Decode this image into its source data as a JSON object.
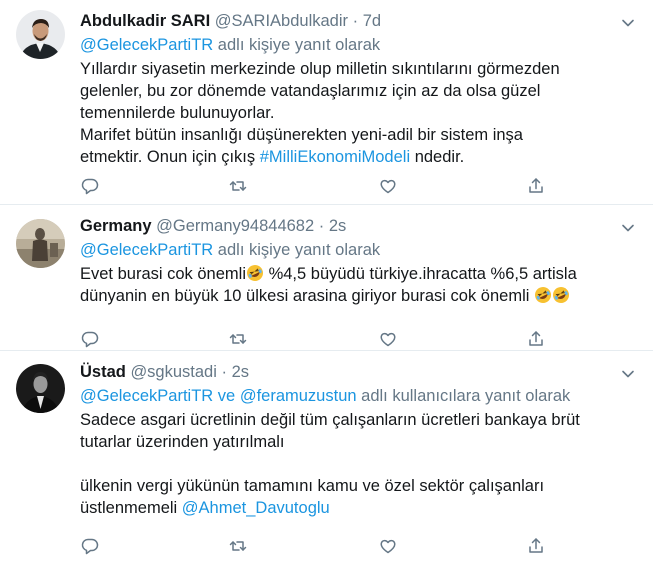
{
  "tweets": [
    {
      "name": "Abdulkadir SARI",
      "handle": "@SARIAbdulkadir",
      "time": "7d",
      "reply_mentions": [
        "@GelecekPartiTR"
      ],
      "reply_connector": "",
      "reply_suffix": "adlı kişiye yanıt olarak",
      "lines": [
        "Yıllardır siyasetin merkezinde olup milletin sıkıntılarını görmezden",
        "gelenler, bu zor dönemde vatandaşlarımız için az da olsa güzel",
        "temennilerde bulunuyorlar.",
        "Marifet bütün insanlığı düşünerekten yeni-adil bir sistem inşa"
      ],
      "last_line_prefix": "etmektir. Onun için çıkış ",
      "hashtag": "#MilliEkonomiModeli",
      "last_line_suffix": " ndedir."
    },
    {
      "name": "Germany",
      "handle": "@Germany94844682",
      "time": "2s",
      "reply_mentions": [
        "@GelecekPartiTR"
      ],
      "reply_connector": "",
      "reply_suffix": "adlı kişiye yanıt olarak",
      "line1_prefix": "Evet burasi cok önemli",
      "line1_suffix": " %4,5 büyüdü türkiye.ihracatta %6,5 artisla",
      "line2": "dünyanin en büyük 10 ülkesi arasina giriyor burasi cok önemli "
    },
    {
      "name": "Üstad",
      "handle": "@sgkustadi",
      "time": "2s",
      "reply_mentions": [
        "@GelecekPartiTR",
        "@feramuzustun"
      ],
      "reply_connector": "ve",
      "reply_suffix": "adlı kullanıcılara yanıt olarak",
      "lines": [
        "Sadece asgari ücretlinin değil tüm çalışanların ücretleri bankaya brüt",
        "tutarlar üzerinden yatırılmalı",
        "",
        "ülkenin vergi yükünün tamamını kamu ve özel sektör çalışanları"
      ],
      "last_line_prefix": "üstlenmemeli ",
      "last_mention": "@Ahmet_Davutoglu"
    }
  ],
  "icons": {
    "reply": "reply-icon",
    "retweet": "retweet-icon",
    "like": "like-icon",
    "share": "share-icon",
    "more": "chevron-down-icon",
    "emoji": "rolling-on-floor-laughing-emoji"
  },
  "colors": {
    "link": "#1b95e0",
    "muted": "#657786",
    "text": "#14171a",
    "divider": "#e6ecf0"
  }
}
